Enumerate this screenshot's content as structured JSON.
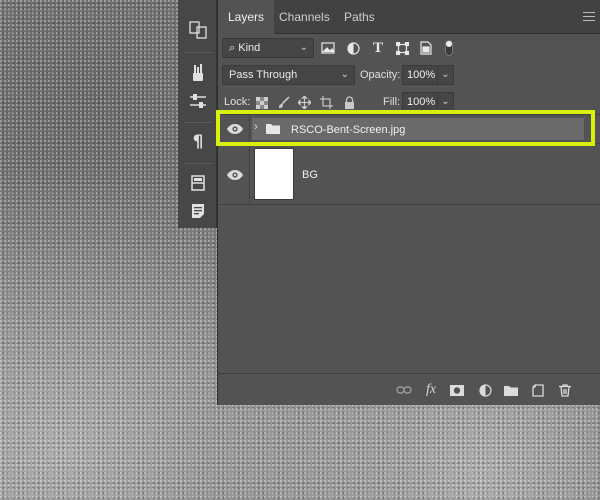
{
  "panel": {
    "tabs": [
      {
        "label": "Layers",
        "active": true
      },
      {
        "label": "Channels",
        "active": false
      },
      {
        "label": "Paths",
        "active": false
      }
    ],
    "filter": {
      "kind_label": "Kind"
    },
    "blend": {
      "mode": "Pass Through",
      "opacity_label": "Opacity:",
      "opacity_value": "100%"
    },
    "lock": {
      "label": "Lock:",
      "fill_label": "Fill:",
      "fill_value": "100%"
    },
    "layers": [
      {
        "name": "RSCO-Bent-Screen.jpg",
        "type": "group",
        "visible": true,
        "selected": true
      },
      {
        "name": "BG",
        "type": "pixel",
        "visible": true,
        "selected": false
      }
    ]
  },
  "tool_strip": {
    "icons": [
      "transform-icon",
      "brush-presets-icon",
      "adjust-sliders-icon",
      "paragraph-icon",
      "properties-icon",
      "notes-icon"
    ]
  },
  "colors": {
    "highlight": "#d8f00a",
    "panel_bg": "#535353",
    "tab_bg": "#424242"
  },
  "footer": {
    "icons": [
      "link-icon",
      "fx-icon",
      "mask-icon",
      "adjustment-icon",
      "folder-icon",
      "new-layer-icon",
      "trash-icon"
    ],
    "fx_label": "fx"
  }
}
